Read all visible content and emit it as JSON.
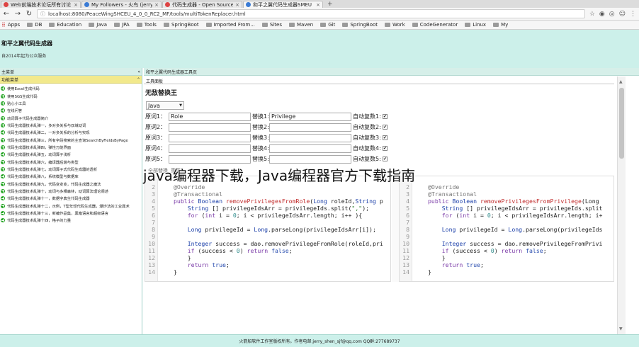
{
  "browser": {
    "tabs": [
      {
        "label": "Web前端技术论坛所有讨论",
        "active": false
      },
      {
        "label": "My Followers - 火鸟 (jerry",
        "active": false
      },
      {
        "label": "代码生成器 - Open Source",
        "active": false
      },
      {
        "label": "和平之翼代码生成器SMEU",
        "active": true
      }
    ],
    "url": "localhost:8080/PeaceWingSHCEU_4_0_0_RC2_MF/tools/multiTokenReplacer.html",
    "bookmarks": [
      "Apps",
      "DB",
      "Education",
      "Java",
      "JPA",
      "Tools",
      "SpringBoot",
      "Imported From...",
      "Sites",
      "Maven",
      "Git",
      "SpringBoot",
      "Work",
      "CodeGenerator",
      "Linux",
      "My"
    ]
  },
  "app": {
    "title": "和平之翼代码生成器",
    "subtitle": "自2014年起为公众服务"
  },
  "sidebar": {
    "header": "主菜单",
    "collapse": "«",
    "submenu_title": "功能菜单",
    "submenu_toggle": "⌃",
    "items": [
      "使用Excel生成代码",
      "使用SGS生成代码",
      "贴心小工具",
      "在线问答",
      "动词算子代码生成器简介",
      "代码生成器技术乱弹一，多对多关系与双域动词",
      "代码生成器技术乱弹二，一对多关系的分析与实现",
      "代码生成器技术乱弹三，所有字段搜索的主查询SearchByFieldsByPage",
      "代码生成器技术乱弹四，弹性万能界面",
      "代码生成器技术乱弹五，动词算子浅析",
      "代码生成器技术乱弹六，编译器后端与类型",
      "代码生成器技术乱弹七，动词算子式代码生成器的透析",
      "代码生成器技术乱弹八，系统模型与数据库",
      "代码生成器技术乱弹九，代码变变变，代码生成器之魔法",
      "代码生成器技术乱弹十，动词与多棵森林，动词算法理论阐述",
      "代码生成器技术乱弹十一，数据字典生代码生成器",
      "代码生成器技术乱弹十二，示例，T型年轻代码生成器，爆炸法的工业属术",
      "代码生成器技术乱弹十三，新编作品集，黑箱语言和超级语言",
      "代码生成器技术乱弹十四，格子的力量"
    ]
  },
  "main": {
    "tab_label": "和平之翼代码生成器工具页",
    "panel_title": "工具面板",
    "heading": "无敌替换王",
    "language": "Java",
    "original_label": "原词",
    "replace_label": "替换",
    "auto_plural_label": "自动复数",
    "rows": [
      {
        "idx": "1",
        "original": "Role",
        "replacement": "Privilege",
        "auto": true
      },
      {
        "idx": "2",
        "original": "",
        "replacement": "",
        "auto": true
      },
      {
        "idx": "3",
        "original": "",
        "replacement": "",
        "auto": true
      },
      {
        "idx": "4",
        "original": "",
        "replacement": "",
        "auto": true
      },
      {
        "idx": "5",
        "original": "",
        "replacement": "",
        "auto": true
      }
    ],
    "buttons": [
      "全部替换",
      "重置"
    ]
  },
  "editor_left": {
    "lines": [
      {
        "n": "2",
        "parts": [
          [
            "an",
            "@Override"
          ]
        ]
      },
      {
        "n": "3",
        "parts": [
          [
            "an",
            "@Transactional"
          ]
        ]
      },
      {
        "n": "4",
        "parts": [
          [
            "k",
            "public "
          ],
          [
            "t",
            "Boolean "
          ],
          [
            "f",
            "removePrivilegesFromRole"
          ],
          [
            "",
            "("
          ],
          [
            "t",
            "Long "
          ],
          [
            "",
            "roleId,"
          ],
          [
            "t",
            "String "
          ],
          [
            "",
            "p"
          ]
        ]
      },
      {
        "n": "5",
        "parts": [
          [
            "",
            "    "
          ],
          [
            "t",
            "String "
          ],
          [
            "",
            "[] privilegeIdsArr = privilegeIds.split("
          ],
          [
            "s",
            "\",\""
          ],
          [
            "",
            ");"
          ]
        ]
      },
      {
        "n": "6",
        "parts": [
          [
            "",
            "    "
          ],
          [
            "k",
            "for "
          ],
          [
            "",
            "("
          ],
          [
            "k",
            "int "
          ],
          [
            "",
            "i = "
          ],
          [
            "n",
            "0"
          ],
          [
            "",
            "; i < privilegeIdsArr.length; i++ ){"
          ]
        ]
      },
      {
        "n": "7",
        "parts": [
          [
            "",
            ""
          ]
        ]
      },
      {
        "n": "8",
        "parts": [
          [
            "",
            "    "
          ],
          [
            "t",
            "Long "
          ],
          [
            "",
            "privilegeId = "
          ],
          [
            "t",
            "Long"
          ],
          [
            "",
            ".parseLong(privilegeIdsArr[i]);"
          ]
        ]
      },
      {
        "n": "9",
        "parts": [
          [
            "",
            ""
          ]
        ]
      },
      {
        "n": "10",
        "parts": [
          [
            "",
            "    "
          ],
          [
            "t",
            "Integer "
          ],
          [
            "",
            "success = dao.removePrivilegeFromRole(roleId,pri"
          ]
        ]
      },
      {
        "n": "11",
        "parts": [
          [
            "",
            "    "
          ],
          [
            "k",
            "if "
          ],
          [
            "",
            "(success < "
          ],
          [
            "n",
            "0"
          ],
          [
            "",
            ") "
          ],
          [
            "k",
            "return "
          ],
          [
            "a",
            "false"
          ],
          [
            "",
            ";"
          ]
        ]
      },
      {
        "n": "12",
        "parts": [
          [
            "",
            "    }"
          ]
        ]
      },
      {
        "n": "13",
        "parts": [
          [
            "",
            "    "
          ],
          [
            "k",
            "return "
          ],
          [
            "a",
            "true"
          ],
          [
            "",
            ";"
          ]
        ]
      },
      {
        "n": "14",
        "parts": [
          [
            "",
            "}"
          ]
        ]
      }
    ]
  },
  "editor_right": {
    "lines": [
      {
        "n": "2",
        "parts": [
          [
            "an",
            "@Override"
          ]
        ]
      },
      {
        "n": "3",
        "parts": [
          [
            "an",
            "@Transactional"
          ]
        ]
      },
      {
        "n": "4",
        "parts": [
          [
            "k",
            "public "
          ],
          [
            "t",
            "Boolean "
          ],
          [
            "f",
            "removePrivilegesFromPrivilege"
          ],
          [
            "",
            "(Long "
          ]
        ]
      },
      {
        "n": "5",
        "parts": [
          [
            "",
            "    "
          ],
          [
            "t",
            "String "
          ],
          [
            "",
            "[] privilegeIdsArr = privilegeIds.split"
          ]
        ]
      },
      {
        "n": "6",
        "parts": [
          [
            "",
            "    "
          ],
          [
            "k",
            "for "
          ],
          [
            "",
            "("
          ],
          [
            "k",
            "int "
          ],
          [
            "",
            "i = "
          ],
          [
            "n",
            "0"
          ],
          [
            "",
            "; i < privilegeIdsArr.length; i+"
          ]
        ]
      },
      {
        "n": "7",
        "parts": [
          [
            "",
            ""
          ]
        ]
      },
      {
        "n": "8",
        "parts": [
          [
            "",
            "    "
          ],
          [
            "t",
            "Long "
          ],
          [
            "",
            "privilegeId = "
          ],
          [
            "t",
            "Long"
          ],
          [
            "",
            ".parseLong(privilegeIds"
          ]
        ]
      },
      {
        "n": "9",
        "parts": [
          [
            "",
            ""
          ]
        ]
      },
      {
        "n": "10",
        "parts": [
          [
            "",
            "    "
          ],
          [
            "t",
            "Integer "
          ],
          [
            "",
            "success = dao.removePrivilegeFromPrivi"
          ]
        ]
      },
      {
        "n": "11",
        "parts": [
          [
            "",
            "    "
          ],
          [
            "k",
            "if "
          ],
          [
            "",
            "(success < "
          ],
          [
            "n",
            "0"
          ],
          [
            "",
            ") "
          ],
          [
            "k",
            "return "
          ],
          [
            "a",
            "false"
          ],
          [
            "",
            ";"
          ]
        ]
      },
      {
        "n": "12",
        "parts": [
          [
            "",
            "    }"
          ]
        ]
      },
      {
        "n": "13",
        "parts": [
          [
            "",
            "    "
          ],
          [
            "k",
            "return "
          ],
          [
            "a",
            "true"
          ],
          [
            "",
            ";"
          ]
        ]
      },
      {
        "n": "14",
        "parts": [
          [
            "",
            "}"
          ]
        ]
      }
    ]
  },
  "overlay_caption": "java编程器下载，Java编程器官方下载指南",
  "footer": "火箭船软件工作室版权所有。作者电邮:jerry_shen_sjf@qq.com QQ群:277689737",
  "colors": {
    "header_bg": "#ccf0ea",
    "submenu_bg": "#f2e98c",
    "menu_icon": "#26a526"
  }
}
